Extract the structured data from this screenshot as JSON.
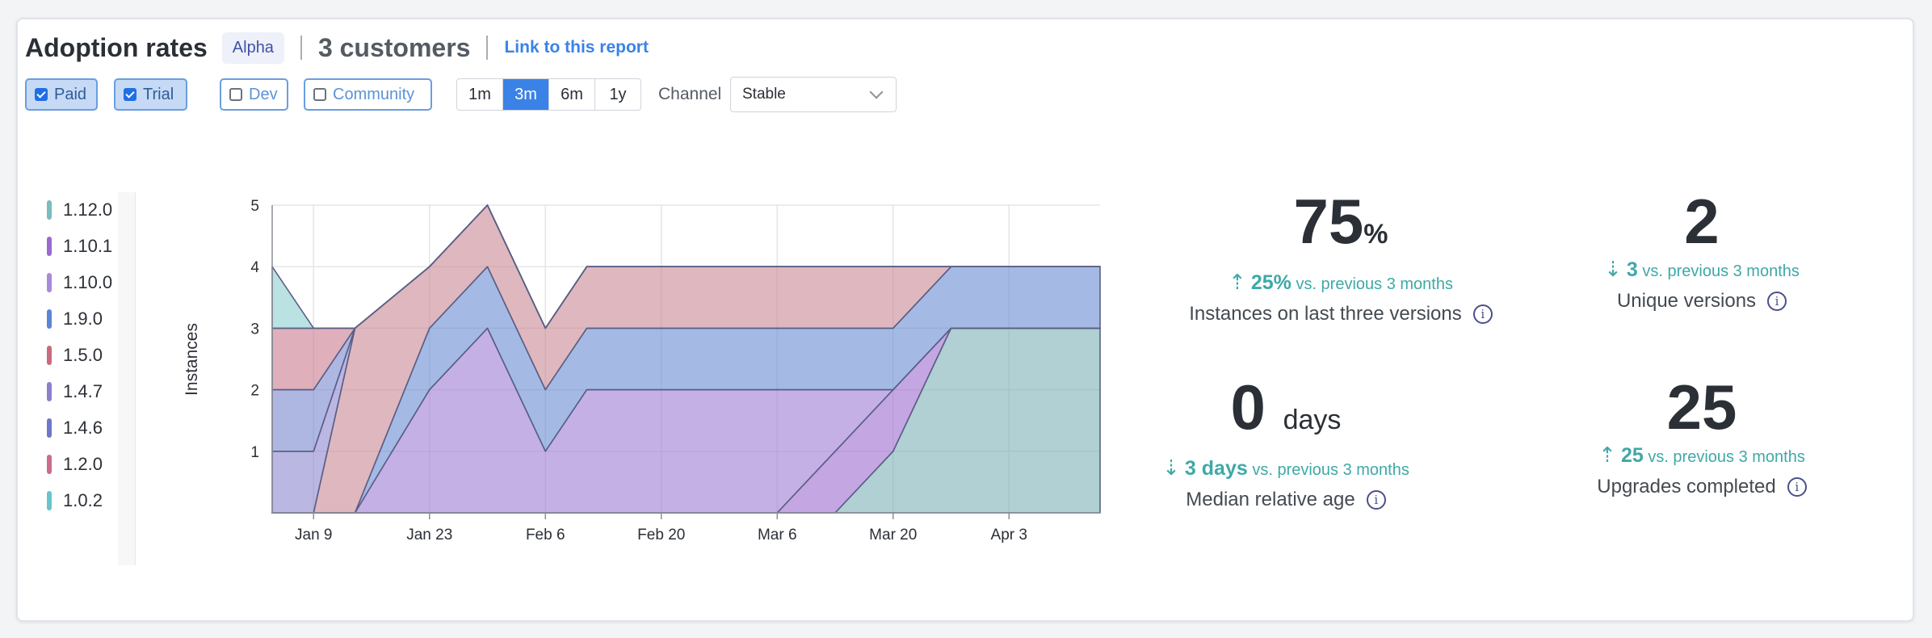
{
  "header": {
    "title": "Adoption rates",
    "badge": "Alpha",
    "customers": "3 customers",
    "link": "Link to this report"
  },
  "filters": {
    "licenses": [
      {
        "label": "Paid",
        "checked": true
      },
      {
        "label": "Trial",
        "checked": true
      },
      {
        "label": "Dev",
        "checked": false
      },
      {
        "label": "Community",
        "checked": false
      }
    ],
    "ranges": [
      "1m",
      "3m",
      "6m",
      "1y"
    ],
    "active_range": "3m",
    "channel_label": "Channel",
    "channel_value": "Stable"
  },
  "legend": [
    {
      "label": "1.12.0",
      "color": "#7bbcbe"
    },
    {
      "label": "1.10.1",
      "color": "#9b6ad0"
    },
    {
      "label": "1.10.0",
      "color": "#a98ad8"
    },
    {
      "label": "1.9.0",
      "color": "#5b85d6"
    },
    {
      "label": "1.5.0",
      "color": "#c86b7e"
    },
    {
      "label": "1.4.7",
      "color": "#8a80cc"
    },
    {
      "label": "1.4.6",
      "color": "#6d78c8"
    },
    {
      "label": "1.2.0",
      "color": "#cc6c88"
    },
    {
      "label": "1.0.2",
      "color": "#67c4cb"
    }
  ],
  "metrics": [
    {
      "value": "75",
      "unit": "%",
      "delta_dir": "up",
      "delta_value": "25%",
      "delta_text": "vs. previous 3 months",
      "caption": "Instances on last three versions"
    },
    {
      "value": "2",
      "unit": "",
      "delta_dir": "down",
      "delta_value": "3",
      "delta_text": "vs. previous 3 months",
      "caption": "Unique versions"
    },
    {
      "value": "0",
      "unit": "days",
      "delta_dir": "down",
      "delta_value": "3 days",
      "delta_text": "vs. previous 3 months",
      "caption": "Median relative age"
    },
    {
      "value": "25",
      "unit": "",
      "delta_dir": "up",
      "delta_value": "25",
      "delta_text": "vs. previous 3 months",
      "caption": "Upgrades completed"
    }
  ],
  "chart_data": {
    "type": "area",
    "stacked": true,
    "ylabel": "Instances",
    "xlabel": "",
    "ylim": [
      0,
      5
    ],
    "yticks": [
      1,
      2,
      3,
      4,
      5
    ],
    "x": [
      "Jan 4",
      "Jan 9",
      "Jan 14",
      "Jan 23",
      "Jan 30",
      "Feb 6",
      "Feb 11",
      "Mar 6",
      "Mar 13",
      "Mar 20",
      "Mar 27",
      "Apr 3",
      "Apr 14"
    ],
    "xticks": [
      "Jan 9",
      "Jan 23",
      "Feb 6",
      "Feb 20",
      "Mar 6",
      "Mar 20",
      "Apr 3"
    ],
    "grid": true,
    "series": [
      {
        "name": "1.12.0",
        "color": "#7fb3b8",
        "values": [
          0,
          0,
          0,
          0,
          0,
          0,
          0,
          0,
          0,
          1,
          3,
          3,
          3
        ]
      },
      {
        "name": "1.10.1",
        "color": "#9f6fd0",
        "values": [
          0,
          0,
          0,
          0,
          0,
          0,
          0,
          0,
          1,
          1,
          0,
          0,
          0
        ]
      },
      {
        "name": "1.10.0",
        "color": "#a27fd6",
        "values": [
          0,
          0,
          0,
          2,
          3,
          1,
          2,
          2,
          1,
          0,
          0,
          0,
          0
        ]
      },
      {
        "name": "1.9.0",
        "color": "#6c8fd4",
        "values": [
          0,
          0,
          0,
          1,
          1,
          1,
          1,
          1,
          1,
          1,
          1,
          1,
          1
        ]
      },
      {
        "name": "1.5.0",
        "color": "#cc8a96",
        "values": [
          0,
          0,
          3,
          1,
          1,
          1,
          1,
          1,
          1,
          1,
          0,
          0,
          0
        ]
      },
      {
        "name": "1.4.7",
        "color": "#8f8ad0",
        "values": [
          1,
          1,
          0,
          0,
          0,
          0,
          0,
          0,
          0,
          0,
          0,
          0,
          0
        ]
      },
      {
        "name": "1.4.6",
        "color": "#7d8ad0",
        "values": [
          1,
          1,
          0,
          0,
          0,
          0,
          0,
          0,
          0,
          0,
          0,
          0,
          0
        ]
      },
      {
        "name": "1.2.0",
        "color": "#cc7f92",
        "values": [
          1,
          1,
          0,
          0,
          0,
          0,
          0,
          0,
          0,
          0,
          0,
          0,
          0
        ]
      },
      {
        "name": "1.0.2",
        "color": "#8fd0d2",
        "values": [
          1,
          0,
          0,
          0,
          0,
          0,
          0,
          0,
          0,
          0,
          0,
          0,
          0
        ]
      }
    ]
  }
}
